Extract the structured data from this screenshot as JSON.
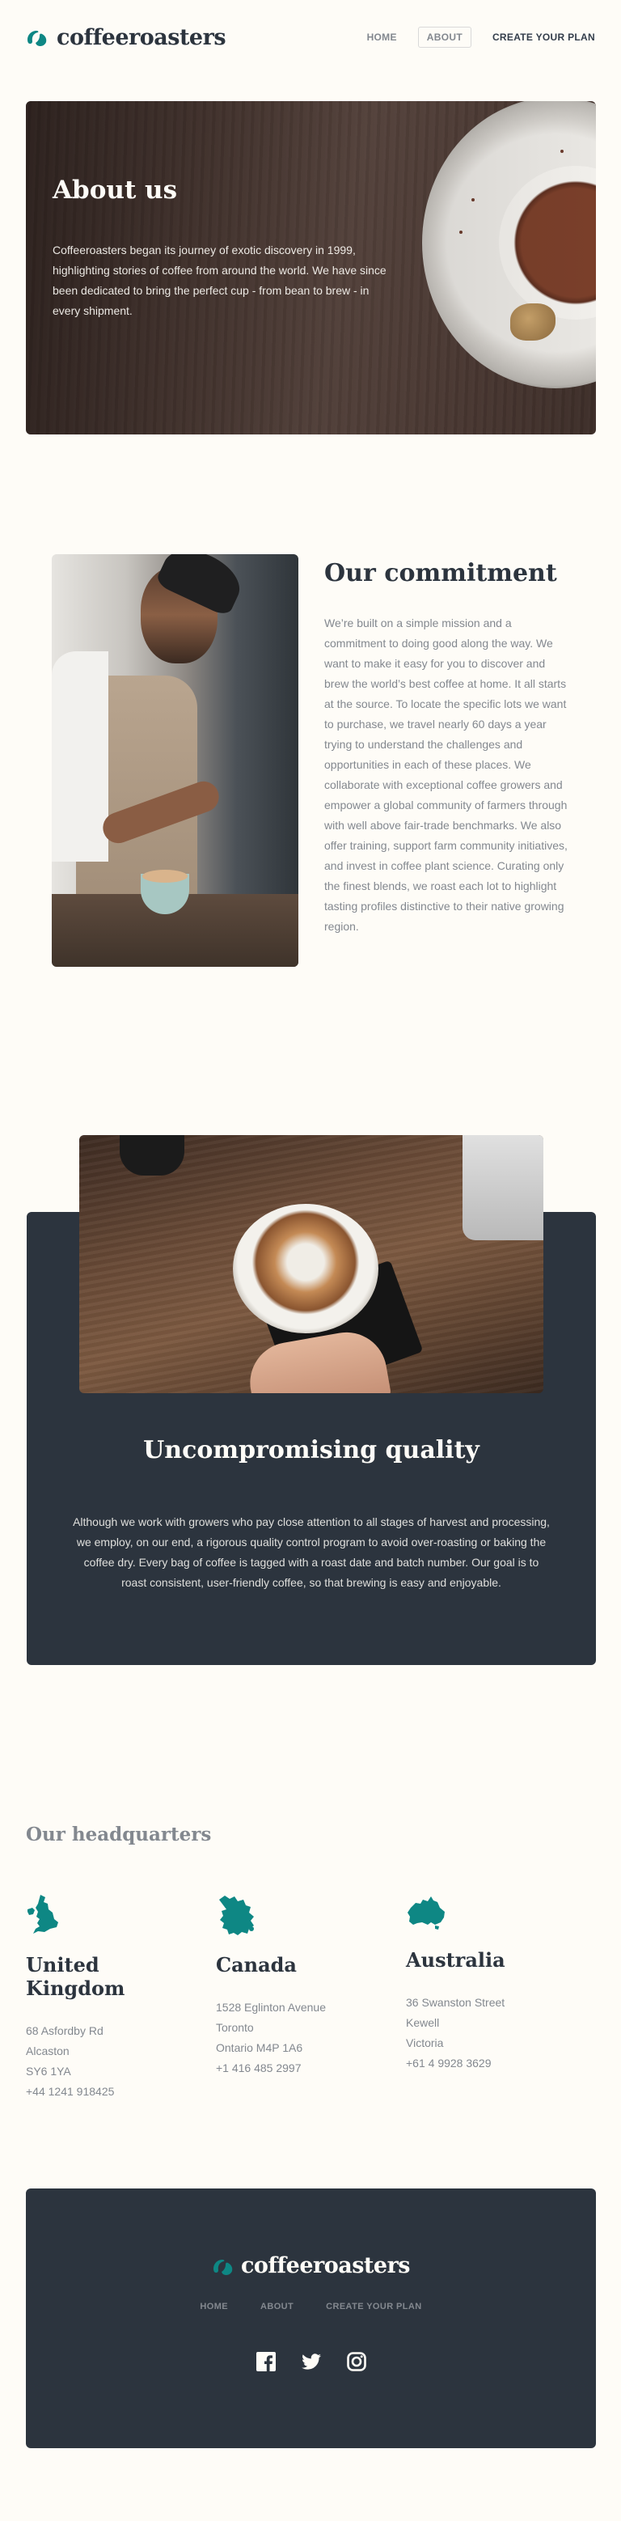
{
  "brand": {
    "name": "coffeeroasters",
    "accent": "#0E8784",
    "dark": "#2C343E",
    "grey": "#83888F",
    "cream": "#FEFCF7"
  },
  "nav": {
    "home": "HOME",
    "about": "ABOUT",
    "plan": "CREATE YOUR PLAN"
  },
  "hero": {
    "title": "About us",
    "text": "Coffeeroasters began its journey of exotic discovery in 1999, highlighting stories of coffee from around the world. We have since been dedicated to bring the perfect cup - from bean to brew - in every shipment."
  },
  "commitment": {
    "title": "Our commitment",
    "text": "We’re built on a simple mission and a commitment to doing good along the way. We want to make it easy for you to discover and brew the world’s best coffee at home. It all starts at the source. To locate the specific lots we want to purchase, we travel nearly 60 days a year trying to understand the challenges and opportunities in each of these places. We collaborate with exceptional coffee growers and empower a global community of farmers through with well above fair-trade benchmarks. We also offer training, support farm community initiatives, and invest in coffee plant science. Curating only the finest blends, we roast each lot to highlight tasting profiles distinctive to their native growing region."
  },
  "quality": {
    "title": "Uncompromising quality",
    "text": "Although we work with growers who pay close attention to all stages of harvest and processing, we employ, on our end, a rigorous quality control program to avoid over-roasting or baking the coffee dry. Every bag of coffee is tagged with a roast date and batch number. Our goal is to roast consistent, user-friendly coffee, so that brewing is easy and enjoyable."
  },
  "hq": {
    "title": "Our headquarters",
    "offices": [
      {
        "country": "United Kingdom",
        "icon": "uk-map-icon",
        "lines": [
          "68 Asfordby Rd",
          "Alcaston",
          "SY6 1YA",
          "+44 1241 918425"
        ]
      },
      {
        "country": "Canada",
        "icon": "canada-map-icon",
        "lines": [
          "1528 Eglinton Avenue",
          "Toronto",
          "Ontario M4P 1A6",
          "+1 416 485 2997"
        ]
      },
      {
        "country": "Australia",
        "icon": "australia-map-icon",
        "lines": [
          "36 Swanston Street",
          "Kewell",
          "Victoria",
          "+61 4 9928 3629"
        ]
      }
    ]
  },
  "footer": {
    "brand": "coffeeroasters",
    "nav": {
      "home": "HOME",
      "about": "ABOUT",
      "plan": "CREATE YOUR PLAN"
    },
    "social": [
      "facebook-icon",
      "twitter-icon",
      "instagram-icon"
    ]
  }
}
